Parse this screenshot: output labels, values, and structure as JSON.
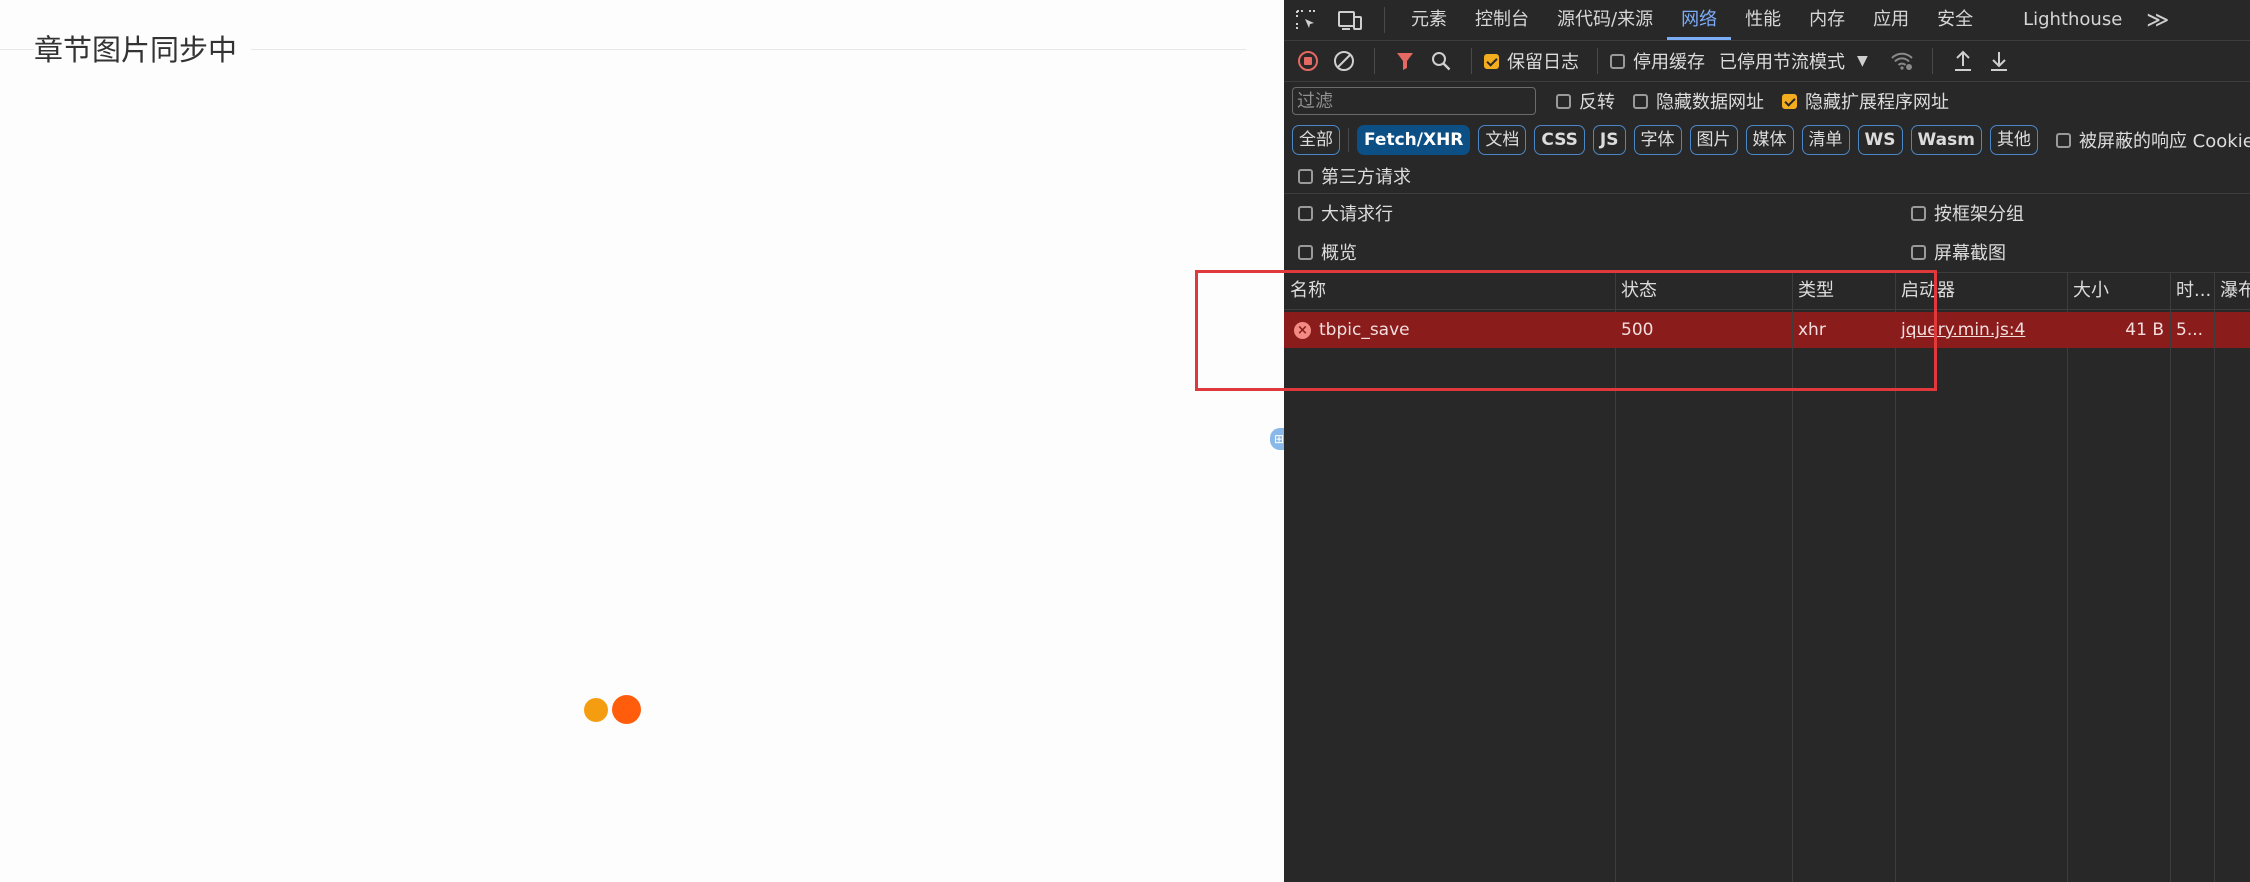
{
  "page": {
    "title": "章节图片同步中"
  },
  "devtools": {
    "tabs": [
      "元素",
      "控制台",
      "源代码/来源",
      "网络",
      "性能",
      "内存",
      "应用",
      "安全",
      "Lighthouse"
    ],
    "active_tab": "网络",
    "more_tabs": "≫",
    "toolbar": {
      "preserve_log": "保留日志",
      "disable_cache": "停用缓存",
      "throttling": "已停用节流模式"
    },
    "filter": {
      "placeholder": "过滤",
      "invert": "反转",
      "hide_data_urls": "隐藏数据网址",
      "hide_extension_urls": "隐藏扩展程序网址"
    },
    "type_filters": [
      "全部",
      "Fetch/XHR",
      "文档",
      "CSS",
      "JS",
      "字体",
      "图片",
      "媒体",
      "清单",
      "WS",
      "Wasm",
      "其他"
    ],
    "active_type": "Fetch/XHR",
    "blocked_cookies": "被屏蔽的响应 Cookie",
    "third_party": "第三方请求",
    "options": {
      "big_rows": "大请求行",
      "group_by_frame": "按框架分组",
      "overview": "概览",
      "screenshots": "屏幕截图"
    },
    "columns": [
      "名称",
      "状态",
      "类型",
      "启动器",
      "大小",
      "时...",
      "瀑布"
    ],
    "requests": [
      {
        "name": "tbpic_save",
        "status": "500",
        "type": "xhr",
        "initiator": "jquery.min.js:4",
        "size": "41 B",
        "time": "5..."
      }
    ],
    "colors": {
      "panel_bg": "#282828",
      "accent": "#7cacf8",
      "error_row": "#8a1c1c",
      "checkbox_on": "#f4ad1e",
      "highlight": "#e0393b"
    }
  }
}
